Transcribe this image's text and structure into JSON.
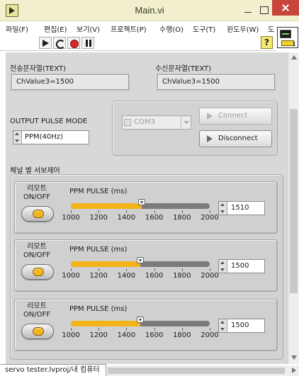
{
  "window": {
    "title": "Main.vi"
  },
  "menu": [
    "파일(F)",
    "편집(E)",
    "보기(V)",
    "프로젝트(P)",
    "수행(O)",
    "도구(T)",
    "윈도우(W)",
    "도"
  ],
  "help_label": "?",
  "vi_icon_number": "1",
  "send_string": {
    "label": "전송문자열(TEXT)",
    "value": "ChValue3=1500"
  },
  "recv_string": {
    "label": "수신문자열(TEXT)",
    "value": "ChValue3=1500"
  },
  "output_mode": {
    "label": "OUTPUT PULSE MODE",
    "value": "PPM(40Hz)"
  },
  "connection": {
    "port": "COM3",
    "connect_label": "Connect",
    "disconnect_label": "Disconnect"
  },
  "servo_section_label": "체널 별 서보제어",
  "servos": [
    {
      "onoff_label": "리모트\nON/OFF",
      "pulse_label": "PPM PULSE (ms)",
      "value": 1510,
      "display": "1510"
    },
    {
      "onoff_label": "리모트\nON/OFF",
      "pulse_label": "PPM PULSE (ms)",
      "value": 1500,
      "display": "1500"
    },
    {
      "onoff_label": "리모트\nON/OFF",
      "pulse_label": "PPM PULSE (ms)",
      "value": 1500,
      "display": "1500"
    }
  ],
  "slider_scale": {
    "min": 1000,
    "max": 2000,
    "ticks": [
      "1000",
      "1200",
      "1400",
      "1600",
      "1800",
      "2000"
    ]
  },
  "status_text": "servo tester.lvproj/내 컴퓨터",
  "colors": {
    "led_on": "#f2b41a",
    "slider_fill": "#f5b31a",
    "slider_track": "#7b7b7b",
    "panel_bg": "#d8d8d8"
  }
}
